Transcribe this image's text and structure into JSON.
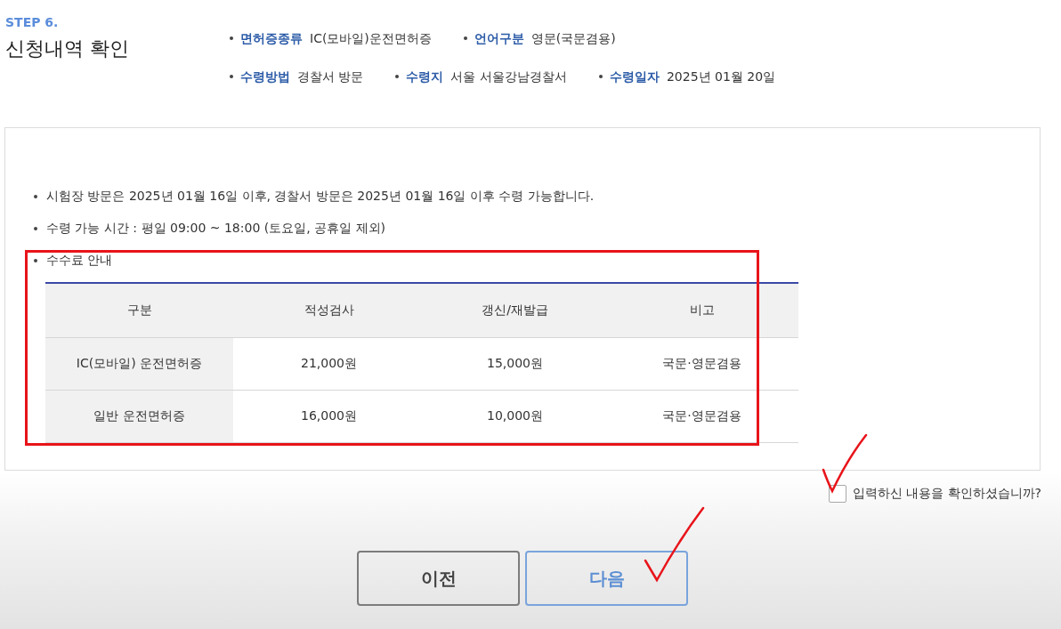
{
  "step": {
    "label": "STEP 6.",
    "title": "신청내역 확인"
  },
  "summary_rows": [
    {
      "items": [
        {
          "label": "면허증종류",
          "value": "IC(모바일)운전면허증"
        },
        {
          "label": "언어구분",
          "value": "영문(국문겸용)"
        }
      ]
    },
    {
      "items": [
        {
          "label": "수령방법",
          "value": "경찰서 방문"
        },
        {
          "label": "수령지",
          "value": "서울 서울강남경찰서"
        },
        {
          "label": "수령일자",
          "value": "2025년 01월 20일"
        }
      ]
    }
  ],
  "notes": [
    {
      "kind": "text",
      "text": "시험장 방문은 2025년 01월 16일 이후, 경찰서 방문은 2025년 01월 16일 이후 수령 가능합니다."
    },
    {
      "kind": "text",
      "text": "수령 가능 시간 : 평일 09:00 ~ 18:00 (토요일, 공휴일 제외)"
    },
    {
      "kind": "fees",
      "text": "수수료 안내",
      "highlighted": true
    }
  ],
  "fee_table": {
    "columns": [
      "구분",
      "적성검사",
      "갱신/재발급",
      "비고"
    ],
    "rows": [
      [
        "IC(모바일) 운전면허증",
        "21,000원",
        "15,000원",
        "국문·영문겸용"
      ],
      [
        "일반 운전면허증",
        "16,000원",
        "10,000원",
        "국문·영문겸용"
      ]
    ]
  },
  "confirm": {
    "label": "입력하신 내용을 확인하셨습니까?",
    "checked": false
  },
  "buttons": [
    {
      "label": "이전",
      "kind": "secondary"
    },
    {
      "label": "다음",
      "kind": "primary"
    }
  ]
}
